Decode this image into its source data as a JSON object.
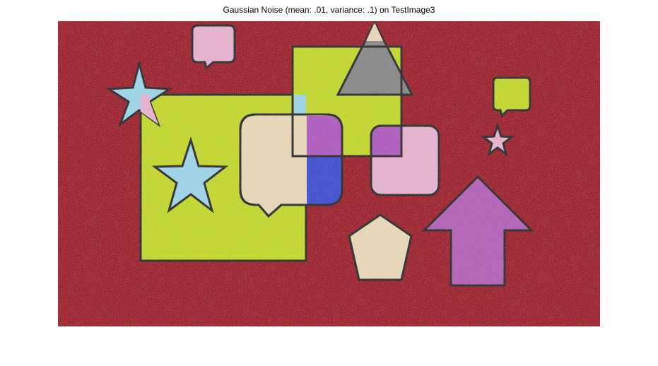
{
  "figure": {
    "title": "Gaussian Noise (mean: .01, variance: .1) on TestImage3"
  },
  "image": {
    "description_colors": {
      "background": "#9e1b2a",
      "lime": "#c4d829",
      "pink": "#e6b4cf",
      "light_blue": "#9fd6e8",
      "cream": "#e8d8b8",
      "purple": "#b262b8",
      "gray": "#8a8a8a",
      "blue": "#3f4fd0",
      "magenta": "#b05cbf",
      "outline": "#2a2a2a"
    },
    "shapes": [
      "large-lime-square",
      "lime-square-top",
      "pink-speech-bubble-top",
      "lime-speech-bubble-right",
      "blue-star-left",
      "blue-star-center",
      "pink-star-right",
      "gray-triangle",
      "cream-speech-bubble",
      "pink-rounded-square",
      "cream-pentagon",
      "purple-arrow"
    ]
  }
}
